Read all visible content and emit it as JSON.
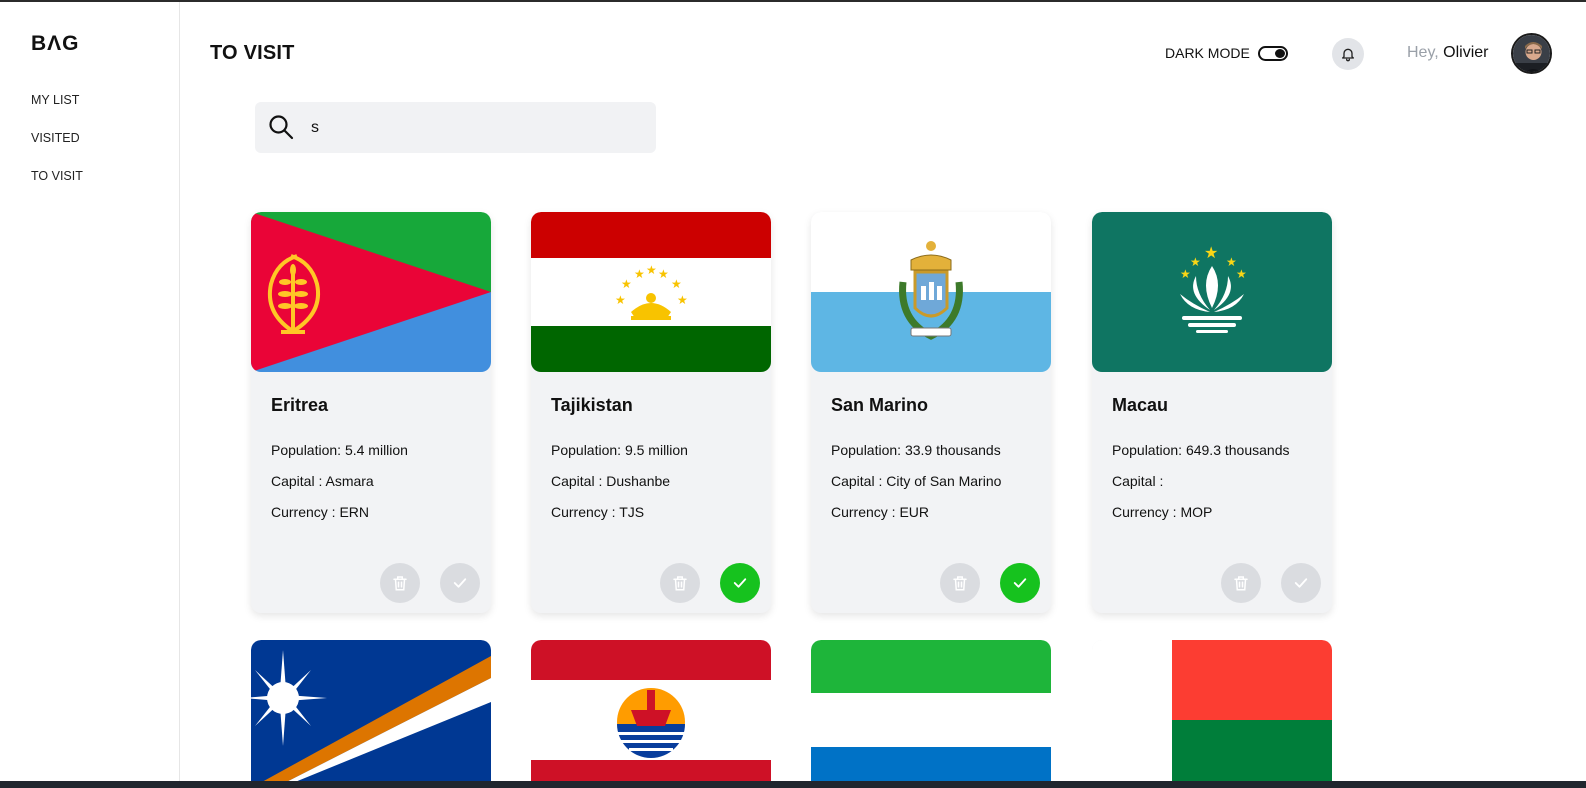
{
  "app": {
    "logo": "BΛG"
  },
  "sidebar": {
    "items": [
      {
        "label": "MY LIST"
      },
      {
        "label": "VISITED"
      },
      {
        "label": "TO VISIT"
      }
    ]
  },
  "header": {
    "title": "TO VISIT",
    "dark_mode_label": "DARK MODE",
    "greeting_hey": "Hey,",
    "greeting_name": "Olivier"
  },
  "search": {
    "value": "s"
  },
  "colors": {
    "accent_green": "#16c21e",
    "button_grey": "#dadce0",
    "card_bg": "#f2f3f5"
  },
  "countries": [
    {
      "name": "Eritrea",
      "population": "Population: 5.4 million",
      "capital": "Capital : Asmara",
      "currency": "Currency : ERN",
      "visited": false,
      "flag": "eritrea"
    },
    {
      "name": "Tajikistan",
      "population": "Population: 9.5 million",
      "capital": "Capital : Dushanbe",
      "currency": "Currency : TJS",
      "visited": true,
      "flag": "tajikistan"
    },
    {
      "name": "San Marino",
      "population": "Population: 33.9 thousands",
      "capital": "Capital : City of San Marino",
      "currency": "Currency : EUR",
      "visited": true,
      "flag": "san-marino"
    },
    {
      "name": "Macau",
      "population": "Population: 649.3 thousands",
      "capital": "Capital :",
      "currency": "Currency : MOP",
      "visited": false,
      "flag": "macau"
    }
  ],
  "partial_row_flags": [
    "marshall-islands",
    "french-polynesia",
    "sierra-leone",
    "madagascar"
  ]
}
